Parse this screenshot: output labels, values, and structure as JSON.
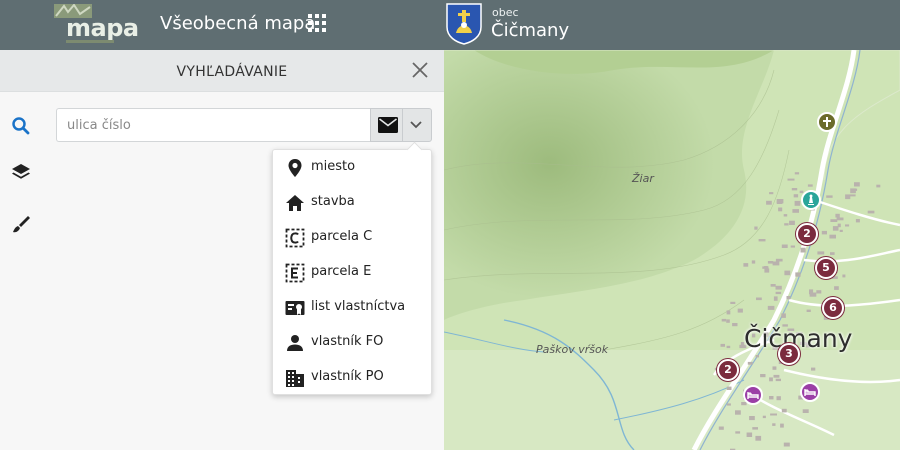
{
  "header": {
    "logo_text": "mapa",
    "app_title": "Všeobecná mapa",
    "municipality_label": "obec",
    "municipality_name": "Čičmany"
  },
  "panel": {
    "title": "VYHĽADÁVANIE",
    "search_placeholder": "ulica číslo",
    "search_value": ""
  },
  "search_types": [
    {
      "label": "miesto",
      "icon": "location-pin-icon"
    },
    {
      "label": "stavba",
      "icon": "house-icon"
    },
    {
      "label": "parcela C",
      "icon": "parcel-c-icon"
    },
    {
      "label": "parcela E",
      "icon": "parcel-e-icon"
    },
    {
      "label": "list vlastníctva",
      "icon": "ownership-sheet-icon"
    },
    {
      "label": "vlastník FO",
      "icon": "person-icon"
    },
    {
      "label": "vlastník PO",
      "icon": "building-icon"
    }
  ],
  "rail": [
    {
      "icon": "search-icon"
    },
    {
      "icon": "layers-icon"
    },
    {
      "icon": "brush-icon"
    }
  ],
  "map": {
    "labels": {
      "ziar": "Žiar",
      "paskov": "Paškov vŕšok",
      "town": "Čičmany"
    },
    "clusters": [
      "2",
      "5",
      "6",
      "3",
      "2"
    ]
  },
  "colors": {
    "header": "#5f6e72",
    "accent": "#1a73c8",
    "cluster": "#7b2b3e",
    "poi_teal": "#2aa59a",
    "poi_purple": "#9b3fa6",
    "poi_church": "#6b6b2a"
  }
}
